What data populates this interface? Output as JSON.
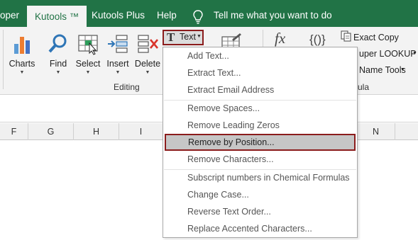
{
  "tabs": {
    "developer_partial": "oper",
    "kutools": "Kutools ™",
    "kutools_plus": "Kutools Plus",
    "help": "Help",
    "tell_me": "Tell me what you want to do"
  },
  "ribbon": {
    "charts": "Charts",
    "find": "Find",
    "select": "Select",
    "insert": "Insert",
    "delete": "Delete",
    "text_button": "Text",
    "editing_group": "Editing",
    "formula_group_partial": "ula",
    "exact_copy": "Exact Copy",
    "super_lookup_partial": "uper LOOKUP",
    "name_tools_partial": "Name Tools",
    "fx": "fx",
    "braces": "{()}"
  },
  "columns": [
    "F",
    "G",
    "H",
    "I",
    "N"
  ],
  "menu": {
    "items": [
      "Add Text...",
      "Extract Text...",
      "Extract Email Address",
      "Remove Spaces...",
      "Remove Leading Zeros",
      "Remove by Position...",
      "Remove Characters...",
      "Subscript numbers in Chemical Formulas",
      "Change Case...",
      "Reverse Text Order...",
      "Replace Accented Characters..."
    ]
  },
  "colors": {
    "ribbon_green": "#217346",
    "highlight_border": "#8b1c1c",
    "selected_fill": "#c6c6c6"
  }
}
